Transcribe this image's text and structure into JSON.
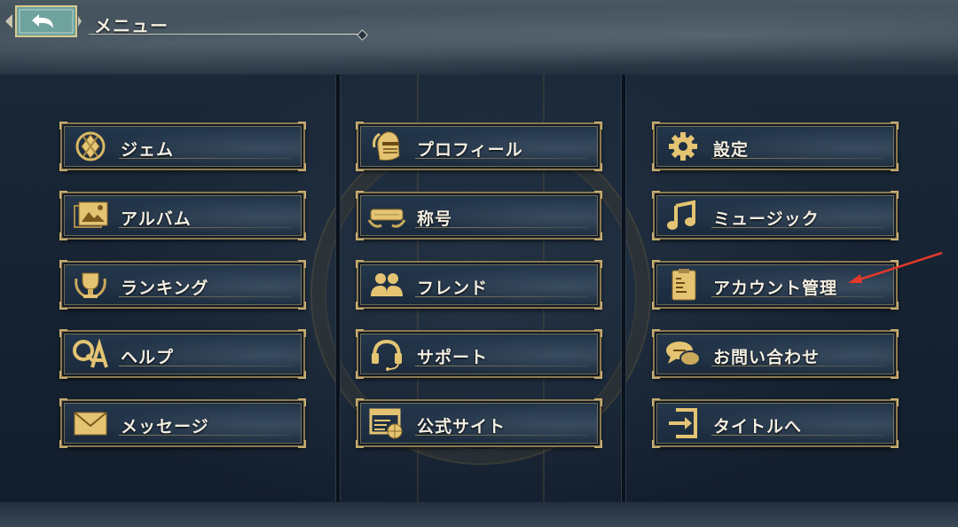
{
  "header": {
    "title": "メニュー"
  },
  "colors": {
    "gold": "#d8b865",
    "button_bg": "#1f3044",
    "annotation_arrow": "#e23a2a"
  },
  "menu": {
    "columns": [
      {
        "items": [
          {
            "label": "ジェム",
            "icon": "gem-icon"
          },
          {
            "label": "アルバム",
            "icon": "album-icon"
          },
          {
            "label": "ランキング",
            "icon": "trophy-icon"
          },
          {
            "label": "ヘルプ",
            "icon": "qa-icon"
          },
          {
            "label": "メッセージ",
            "icon": "envelope-icon"
          }
        ]
      },
      {
        "items": [
          {
            "label": "プロフィール",
            "icon": "knight-helmet-icon"
          },
          {
            "label": "称号",
            "icon": "title-banner-icon"
          },
          {
            "label": "フレンド",
            "icon": "friends-icon"
          },
          {
            "label": "サポート",
            "icon": "headset-icon"
          },
          {
            "label": "公式サイト",
            "icon": "website-icon"
          }
        ]
      },
      {
        "items": [
          {
            "label": "設定",
            "icon": "gear-icon"
          },
          {
            "label": "ミュージック",
            "icon": "music-note-icon"
          },
          {
            "label": "アカウント管理",
            "icon": "account-clipboard-icon"
          },
          {
            "label": "お問い合わせ",
            "icon": "chat-bubbles-icon"
          },
          {
            "label": "タイトルへ",
            "icon": "exit-door-icon"
          }
        ]
      }
    ]
  }
}
